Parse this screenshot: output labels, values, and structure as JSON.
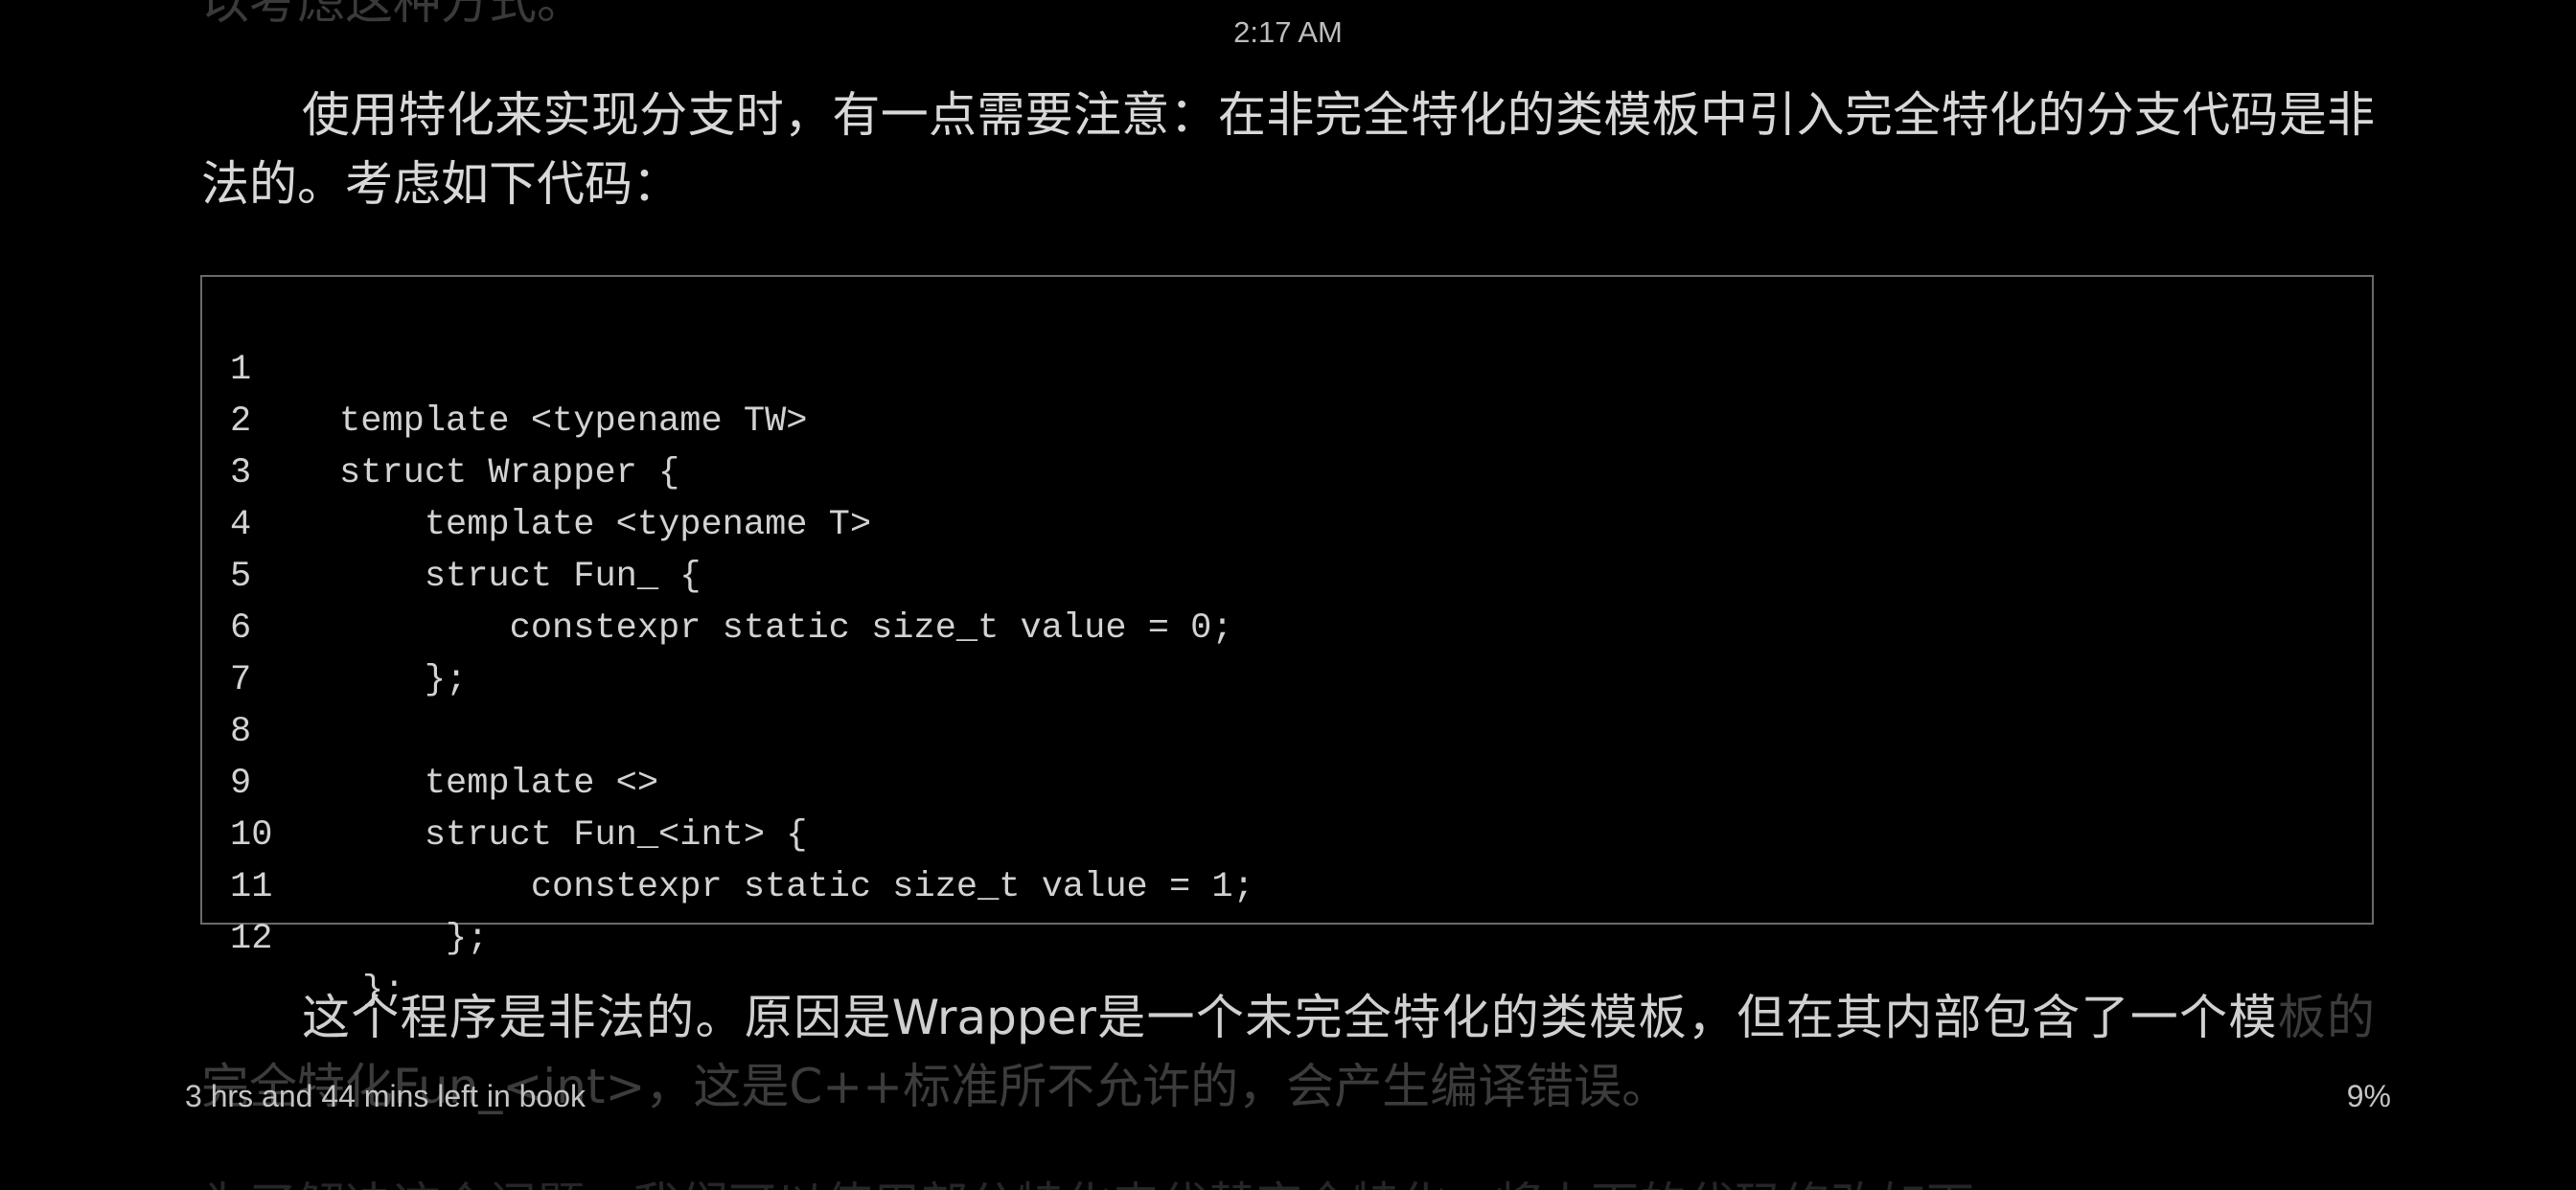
{
  "status_bar": {
    "time": "2:17 AM"
  },
  "book": {
    "top_fragment": "以考虑这种方式。",
    "paragraph1": "使用特化来实现分支时，有一点需要注意：在非完全特化的类模板中引入完全特化的分支代码是非法的。考虑如下代码：",
    "code_lines": [
      {
        "num": "1",
        "text": "template <typename TW>"
      },
      {
        "num": "2",
        "text": "struct Wrapper {"
      },
      {
        "num": "3",
        "text": "    template <typename T>"
      },
      {
        "num": "4",
        "text": "    struct Fun_ {"
      },
      {
        "num": "5",
        "text": "        constexpr static size_t value = 0;"
      },
      {
        "num": "6",
        "text": "    };"
      },
      {
        "num": "7",
        "text": ""
      },
      {
        "num": "8",
        "text": "    template <>"
      },
      {
        "num": "9",
        "text": "    struct Fun_<int> {"
      },
      {
        "num": "10",
        "text": "         constexpr static size_t value = 1;"
      },
      {
        "num": "11",
        "text": "     };"
      },
      {
        "num": "12",
        "text": "};"
      }
    ],
    "paragraph2_main": "这个程序是非法的。原因是Wrapper是一个未完全特化的类模板，但在其内部包含了一个模",
    "paragraph2_dim": "板的完全特化Fun_<int>，这是C++标准所不允许的，会产生编译错误。",
    "bottom_fragment": "为了解决这个问题，我们可以使用部分特化来代替完全特化，将上面的代码修改如下："
  },
  "footer": {
    "time_left": "3 hrs and 44 mins left in book",
    "progress": "9%"
  }
}
